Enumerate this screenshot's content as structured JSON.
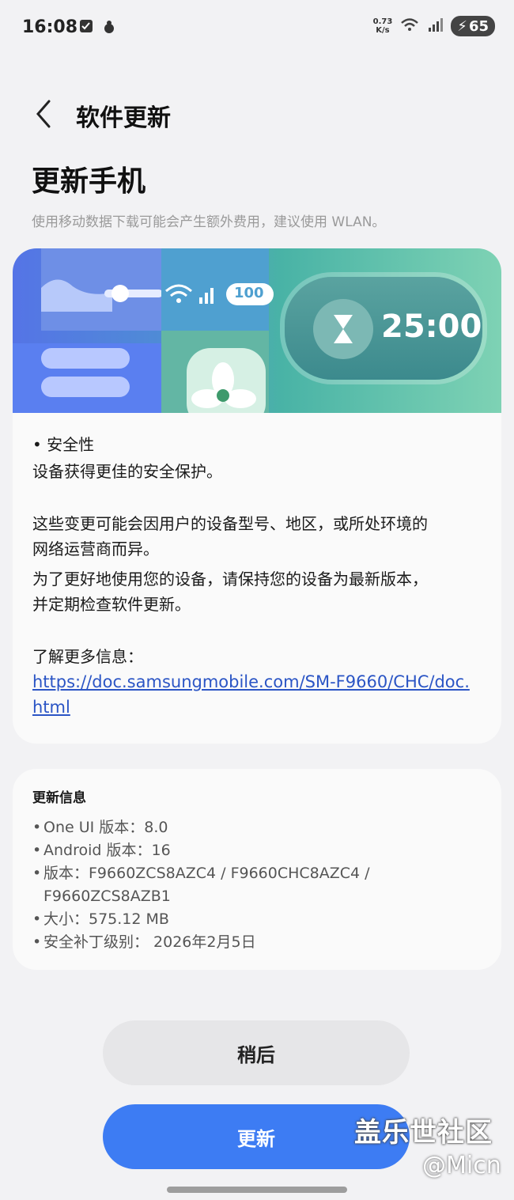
{
  "status_bar": {
    "time": "16:08",
    "net_speed_value": "0.73",
    "net_speed_unit": "K/s",
    "battery": "65"
  },
  "header": {
    "title": "软件更新",
    "page_heading": "更新手机",
    "note": "使用移动数据下载可能会产生额外费用，建议使用 WLAN。"
  },
  "banner": {
    "battery_chip": "100",
    "timer": "25:00"
  },
  "details": {
    "bullet_heading": "• 安全性",
    "bullet_body": "设备获得更佳的安全保护。",
    "para1_line1": "这些变更可能会因用户的设备型号、地区，或所处环境的",
    "para1_line2": "网络运营商而异。",
    "para2_line1": "为了更好地使用您的设备，请保持您的设备为最新版本，",
    "para2_line2": "并定期检查软件更新。",
    "more_info_label": "了解更多信息：",
    "link": "https://doc.samsungmobile.com/SM-F9660/CHC/doc.html"
  },
  "update_info": {
    "title": "更新信息",
    "one_ui": "One UI 版本：8.0",
    "android": "Android 版本：16",
    "version_line1": "版本：F9660ZCS8AZC4 / F9660CHC8AZC4 /",
    "version_line2": "F9660ZCS8AZB1",
    "size": "大小：575.12 MB",
    "security_patch": "安全补丁级别： 2026年2月5日"
  },
  "buttons": {
    "later": "稍后",
    "update": "更新"
  },
  "watermark": {
    "line1": "盖乐世社区",
    "line2": "@Micn"
  },
  "colors": {
    "accent": "#3d7cf3",
    "link": "#2b55c5",
    "background": "#f2f2f4"
  },
  "icons": [
    "checkbox-icon",
    "notification-icon",
    "wifi-icon",
    "signal-icon",
    "battery-icon",
    "back-arrow-icon",
    "hourglass-icon",
    "fan-icon"
  ]
}
